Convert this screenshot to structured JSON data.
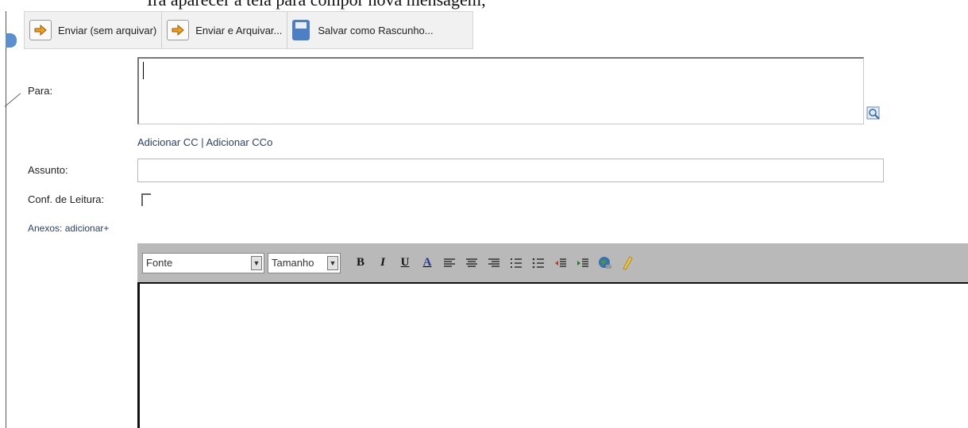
{
  "caption": "Irá aparecer a tela para compor nova mensagem;",
  "toolbar": {
    "send_no_archive": "Enviar (sem arquivar)",
    "send_and_archive": "Enviar e Arquivar...",
    "save_draft": "Salvar como Rascunho..."
  },
  "form": {
    "to_label": "Para:",
    "add_cc": "Adicionar CC",
    "separator": " | ",
    "add_bcc": "Adicionar CCo",
    "subject_label": "Assunto:",
    "read_receipt_label": "Conf. de Leitura:",
    "attachments_label": "Anexos: adicionar+"
  },
  "editor": {
    "font_select": "Fonte",
    "size_select": "Tamanho",
    "bold": "B",
    "italic": "I",
    "underline": "U",
    "font_color": "A"
  },
  "colors": {
    "toolbar_bg": "#f1f1f1",
    "editor_bar_bg": "#b9b9b9",
    "link": "#2c3f70"
  }
}
